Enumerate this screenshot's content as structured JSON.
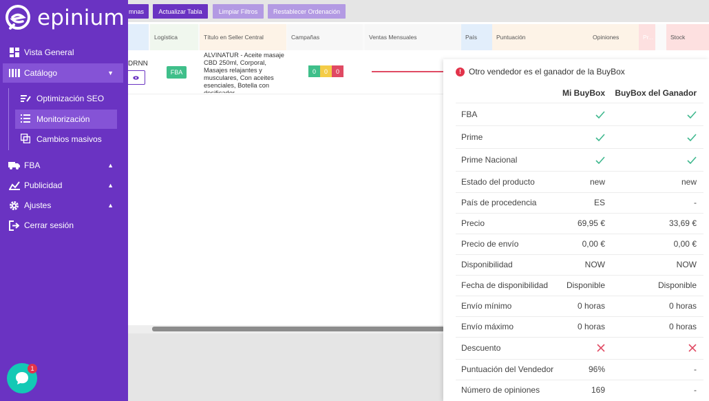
{
  "app": {
    "name": "epinium"
  },
  "sidebar": {
    "items": [
      {
        "label": "Vista General",
        "icon": "dashboard-icon"
      },
      {
        "label": "Catálogo",
        "icon": "catalog-icon"
      },
      {
        "label": "FBA",
        "icon": "truck-icon"
      },
      {
        "label": "Publicidad",
        "icon": "megaphone-icon"
      },
      {
        "label": "Ajustes",
        "icon": "gear-icon"
      },
      {
        "label": "Cerrar sesión",
        "icon": "logout-icon"
      }
    ],
    "catalog_sub": [
      {
        "label": "Optimización SEO",
        "icon": "edit-list-icon"
      },
      {
        "label": "Monitorización",
        "icon": "list-icon"
      },
      {
        "label": "Cambios masivos",
        "icon": "copy-icon"
      }
    ]
  },
  "chat": {
    "badge": "1"
  },
  "toolbar": {
    "columns_label": "mnas",
    "update_label": "Actualizar Tabla",
    "clear_label": "Limpiar Filtros",
    "reset_label": "Restablecer Ordenación"
  },
  "table": {
    "headers": [
      "Logística",
      "Título en Seller Central",
      "Campañas",
      "Ventas Mensuales",
      "País",
      "Puntuación",
      "Opiniones",
      "Pr...",
      "Stock"
    ],
    "row": {
      "id_fragment": "DRNN",
      "logistics": "FBA",
      "title": "ALVINATUR - Aceite masaje CBD 250ml, Corporal, Masajes relajantes y musculares, Con aceites esenciales, Botella con dosificador",
      "campaigns": [
        "0",
        "0",
        "0"
      ]
    }
  },
  "buybox": {
    "title": "Otro vendedor es el ganador de la BuyBox",
    "col_mine": "Mi BuyBox",
    "col_winner": "BuyBox del Ganador",
    "rows": [
      {
        "label": "FBA",
        "mine": "check",
        "winner": "check"
      },
      {
        "label": "Prime",
        "mine": "check",
        "winner": "check"
      },
      {
        "label": "Prime Nacional",
        "mine": "check",
        "winner": "check"
      },
      {
        "label": "Estado del producto",
        "mine": "new",
        "winner": "new"
      },
      {
        "label": "País de procedencia",
        "mine": "ES",
        "winner": "-"
      },
      {
        "label": "Precio",
        "mine": "69,95 €",
        "winner": "33,69 €"
      },
      {
        "label": "Precio de envío",
        "mine": "0,00 €",
        "winner": "0,00 €"
      },
      {
        "label": "Disponibilidad",
        "mine": "NOW",
        "winner": "NOW"
      },
      {
        "label": "Fecha de disponibilidad",
        "mine": "Disponible",
        "winner": "Disponible"
      },
      {
        "label": "Envío mínimo",
        "mine": "0 horas",
        "winner": "0 horas"
      },
      {
        "label": "Envío máximo",
        "mine": "0 horas",
        "winner": "0 horas"
      },
      {
        "label": "Descuento",
        "mine": "cross",
        "winner": "cross"
      },
      {
        "label": "Puntuación del Vendedor",
        "mine": "96%",
        "winner": "-"
      },
      {
        "label": "Número de opiniones",
        "mine": "169",
        "winner": "-"
      }
    ]
  }
}
